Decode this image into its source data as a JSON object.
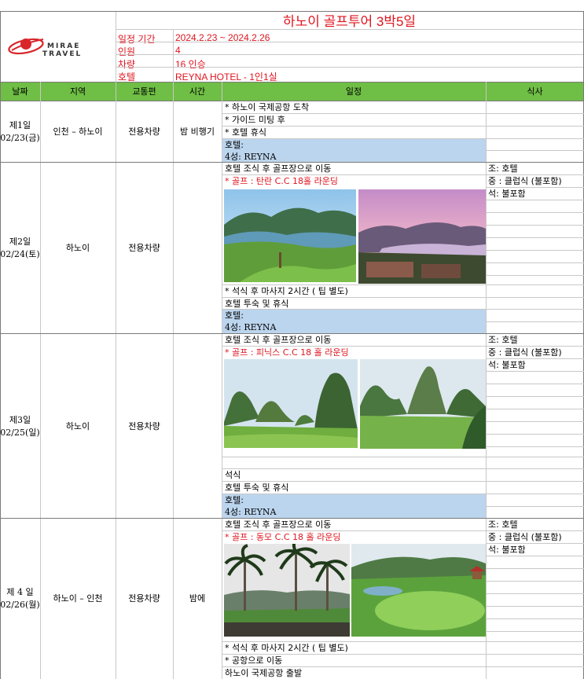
{
  "header": {
    "title": "하노이 골프투어 3박5일",
    "logo": {
      "line1": "MIRAE",
      "line2": "TRAVEL",
      "brand_color": "#d8262a"
    },
    "info": [
      {
        "label": "일정 기간",
        "value": "2024.2.23 ~ 2024.2.26"
      },
      {
        "label": "인원",
        "value": "4"
      },
      {
        "label": "차량",
        "value": "16 인승"
      },
      {
        "label": "호텔",
        "value": "REYNA HOTEL -  1인1실"
      }
    ]
  },
  "columns": [
    "날짜",
    "지역",
    "교통편",
    "시간",
    "일정",
    "식사"
  ],
  "colors": {
    "header_green": "#6fbe45",
    "hotel_blue": "#bcd5ee",
    "accent_red": "#e0141e"
  },
  "days": [
    {
      "day": "제1일",
      "date": "02/23(금)",
      "region": "인천 – 하노이",
      "transport": "전용차량",
      "time": "밤 비행기",
      "schedule": [
        "* 하노이 국제공항 도착",
        "* 가이드 미팅 후",
        "* 호텔 휴식"
      ],
      "hotel": [
        "호텔:",
        "4성: REYNA"
      ],
      "meals": []
    },
    {
      "day": "제2일",
      "date": "02/24(토)",
      "region": "하노이",
      "transport": "전용차량",
      "time": "",
      "schedule_top": [
        "호텔 조식 후 골프장으로 이동"
      ],
      "golf": "* 골프 : 탄란 C.C 18홀 라운딩",
      "schedule_bottom": [
        "* 석식 후 마사지 2시간 ( 팁 별도)",
        "호텔 투숙 및 휴식"
      ],
      "hotel": [
        "호텔:",
        "4성: REYNA"
      ],
      "meals": [
        "조: 호텔",
        "중 : 클럽식 (불포함)",
        "석: 불포함"
      ]
    },
    {
      "day": "제3일",
      "date": "02/25(일)",
      "region": "하노이",
      "transport": "전용차량",
      "time": "",
      "schedule_top": [
        "호텔 조식 후 골프장으로 이동"
      ],
      "golf": "* 골프 : 피닉스 C.C 18 홀 라운딩",
      "schedule_bottom": [
        "석식",
        "호텔 투숙 및 휴식"
      ],
      "hotel": [
        "호텔:",
        "4성: REYNA"
      ],
      "meals": [
        "조: 호텔",
        "중 : 클럽식 (불포함)",
        "석: 불포함"
      ]
    },
    {
      "day": "제 4 일",
      "date": "02/26(월)",
      "region": "하노이 – 인천",
      "transport": "전용차량",
      "time": "밤에",
      "schedule_top": [
        "호텔 조식 후 골프장으로 이동"
      ],
      "golf": "* 골프 : 동모 C.C 18 홀 라운딩",
      "schedule_bottom": [
        "* 석식 후 마사지 2시간 ( 팁 별도)",
        "* 공항으로 이동",
        "하노이 국제공항 출발"
      ],
      "meals": [
        "조: 호텔",
        "중 : 클럽식 (불포함)",
        "석: 불포함"
      ]
    }
  ]
}
